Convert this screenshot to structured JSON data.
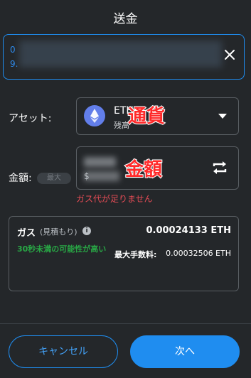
{
  "header": {
    "title": "送金"
  },
  "recipient": {
    "line1": "0",
    "line2": "9.",
    "close_icon": "close-icon"
  },
  "asset": {
    "label": "アセット:",
    "symbol": "ETH",
    "balance_label": "残高",
    "icon": "ethereum-icon",
    "annotation": "通貨"
  },
  "amount": {
    "label": "金額:",
    "max_label": "最大",
    "prefix": "$",
    "annotation": "金額",
    "swap_icon": "swap-icon",
    "error": "ガス代が足りません"
  },
  "gas": {
    "title": "ガス",
    "subtitle": "(見積もり)",
    "info_icon": "info-icon",
    "value": "0.00024133 ETH",
    "likely_text": "30秒未満の可能性が高い",
    "max_fee_label": "最大手数料:",
    "max_fee_value": "0.00032506 ETH"
  },
  "footer": {
    "cancel_label": "キャンセル",
    "next_label": "次へ"
  },
  "colors": {
    "accent": "#1f8df0",
    "error": "#e64c56",
    "success": "#28a745",
    "background": "#24272a"
  }
}
